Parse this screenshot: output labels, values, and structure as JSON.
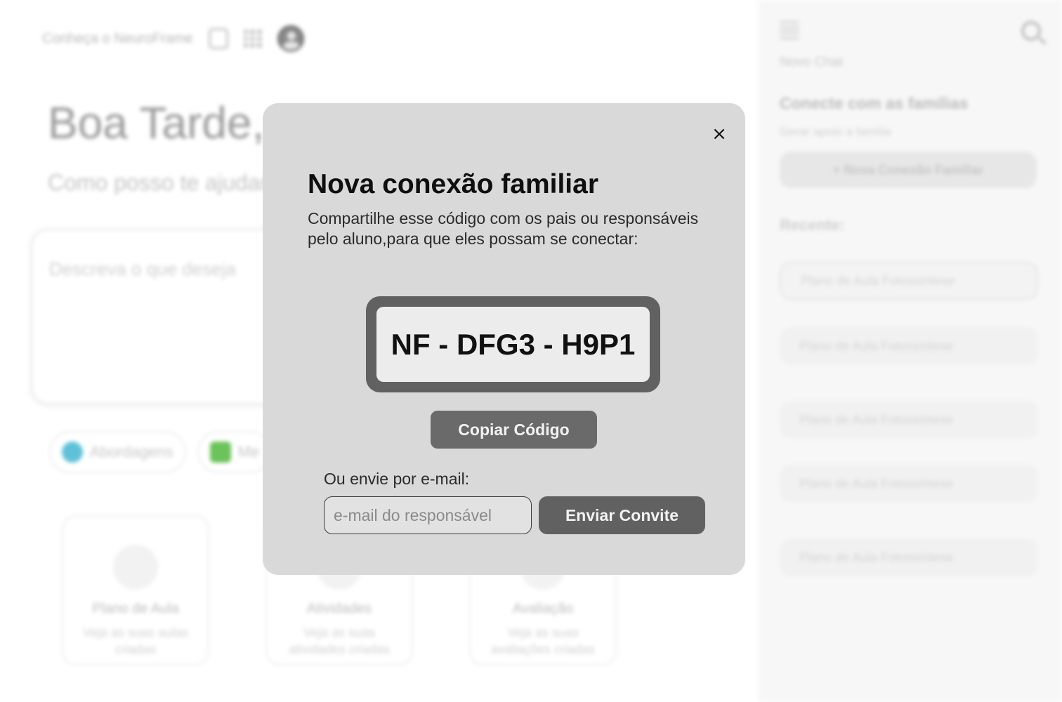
{
  "background": {
    "topbar": {
      "link_label": "Conheça o NeuroFrame",
      "icons": [
        "box-icon",
        "grid-icon",
        "user-avatar-icon"
      ]
    },
    "greeting": "Boa Tarde,",
    "subgreeting": "Como posso te ajudar",
    "prompt_placeholder": "Descreva o que deseja",
    "chips": [
      {
        "label": "Abordagens",
        "icon": "check-circle-icon"
      },
      {
        "label": "Me",
        "icon": "puzzle-icon"
      }
    ],
    "cards": [
      {
        "title": "Plano de Aula",
        "desc": "Veja as suas aulas criadas",
        "icon": "document-icon"
      },
      {
        "title": "Atividades",
        "desc": "Veja as suas atividades criadas",
        "icon": "activity-icon"
      },
      {
        "title": "Avaliação",
        "desc": "Veja as suas avaliações criadas",
        "icon": "evaluation-icon"
      }
    ],
    "sidebar": {
      "new_chat": "Novo Chat",
      "connect_title": "Conecte com as famílias",
      "connect_subtitle": "Gerar apoio a família",
      "new_connection_button": "+ Nova Conexão Familiar",
      "recent_label": "Recente:",
      "recent_items": [
        "Plano de Aula Fotossíntese",
        "Plano de Aula Fotossíntese",
        "Plano de Aula Fotossíntese",
        "Plano de Aula Fotossíntese",
        "Plano de Aula Fotossíntese"
      ]
    }
  },
  "modal": {
    "close_icon": "×",
    "title": "Nova conexão familiar",
    "description": "Compartilhe esse código com os pais ou responsáveis pelo aluno,para que eles possam se conectar:",
    "code": "NF - DFG3 - H9P1",
    "copy_button": "Copiar Código",
    "email_label": "Ou envie por e-mail:",
    "email_placeholder": "e-mail do responsável",
    "email_value": "",
    "send_button": "Enviar Convite"
  }
}
